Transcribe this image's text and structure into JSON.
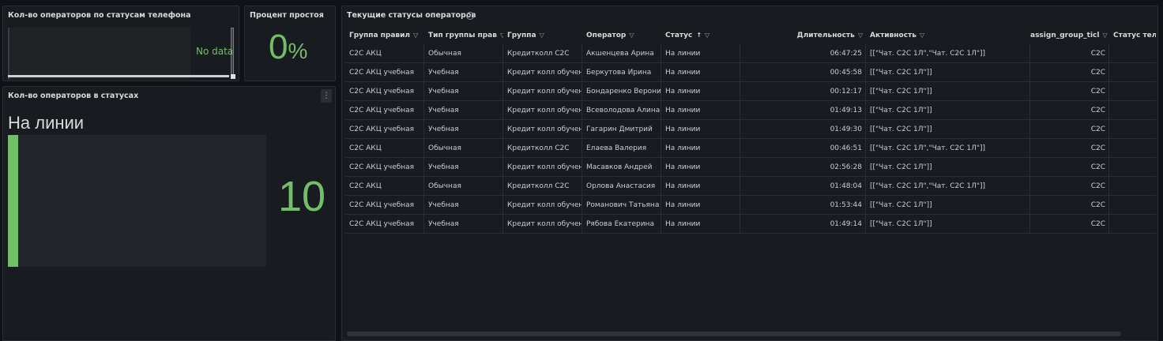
{
  "panels": {
    "phone_statuses": {
      "title": "Кол-во операторов по статусам телефона",
      "no_data": "No data"
    },
    "idle_percent": {
      "title": "Процент простоя",
      "value": "0",
      "unit": "%"
    },
    "operators_in_statuses": {
      "title": "Кол-во операторов в статусах",
      "menu_icon": "more-vertical-icon",
      "status_label": "На линии",
      "count": "10",
      "bar_fraction": 0.04
    },
    "current_statuses": {
      "title": "Текущие статусы операторов",
      "columns": [
        {
          "label": "Группа правил",
          "filter": true
        },
        {
          "label": "Тип группы прав",
          "filter": true
        },
        {
          "label": "Группа",
          "filter": true
        },
        {
          "label": "Оператор",
          "filter": true
        },
        {
          "label": "Статус",
          "sort": "↑",
          "filter": true
        },
        {
          "label": "Длительность",
          "filter": true
        },
        {
          "label": "Активность",
          "filter": true
        },
        {
          "label": "assign_group_ticl",
          "filter": true
        },
        {
          "label": "Статус теле",
          "filter": false
        }
      ],
      "rows": [
        [
          "С2С АКЦ",
          "Обычная",
          "Кредитколл С2С",
          "Акшенцева Арина",
          "На линии",
          "06:47:25",
          "[[\"Чат. С2С 1Л\",\"Чат. С2С 1Л\"]]",
          "С2С",
          ""
        ],
        [
          "С2С АКЦ учебная",
          "Учебная",
          "Кредит колл обучен",
          "Беркутова Ирина",
          "На линии",
          "00:45:58",
          "[[\"Чат. С2С 1Л\"]]",
          "С2С",
          ""
        ],
        [
          "С2С АКЦ учебная",
          "Учебная",
          "Кредит колл обучен",
          "Бондаренко Верони",
          "На линии",
          "00:12:17",
          "[[\"Чат. С2С 1Л\"]]",
          "С2С",
          ""
        ],
        [
          "С2С АКЦ учебная",
          "Учебная",
          "Кредит колл обучен",
          "Всеволодова Алина",
          "На линии",
          "01:49:13",
          "[[\"Чат. С2С 1Л\"]]",
          "С2С",
          ""
        ],
        [
          "С2С АКЦ учебная",
          "Учебная",
          "Кредит колл обучен",
          "Гагарин Дмитрий",
          "На линии",
          "01:49:30",
          "[[\"Чат. С2С 1Л\"]]",
          "С2С",
          ""
        ],
        [
          "С2С АКЦ",
          "Обычная",
          "Кредитколл С2С",
          "Елаева Валерия",
          "На линии",
          "00:46:51",
          "[[\"Чат. С2С 1Л\",\"Чат. С2С 1Л\"]]",
          "С2С",
          ""
        ],
        [
          "С2С АКЦ учебная",
          "Учебная",
          "Кредит колл обучен",
          "Масавков Андрей",
          "На линии",
          "02:56:28",
          "[[\"Чат. С2С 1Л\"]]",
          "С2С",
          ""
        ],
        [
          "С2С АКЦ",
          "Обычная",
          "Кредитколл С2С",
          "Орлова Анастасия",
          "На линии",
          "01:48:04",
          "[[\"Чат. С2С 1Л\",\"Чат. С2С 1Л\"]]",
          "С2С",
          ""
        ],
        [
          "С2С АКЦ учебная",
          "Учебная",
          "Кредит колл обучен",
          "Романович Татьяна",
          "На линии",
          "01:53:44",
          "[[\"Чат. С2С 1Л\"]]",
          "С2С",
          ""
        ],
        [
          "С2С АКЦ учебная",
          "Учебная",
          "Кредит колл обучен",
          "Рябова Екатерина",
          "На линии",
          "01:49:14",
          "[[\"Чат. С2С 1Л\"]]",
          "С2С",
          ""
        ]
      ]
    }
  },
  "colors": {
    "accent_green": "#73bf69",
    "panel_bg": "#181b1f",
    "page_bg": "#111217"
  }
}
